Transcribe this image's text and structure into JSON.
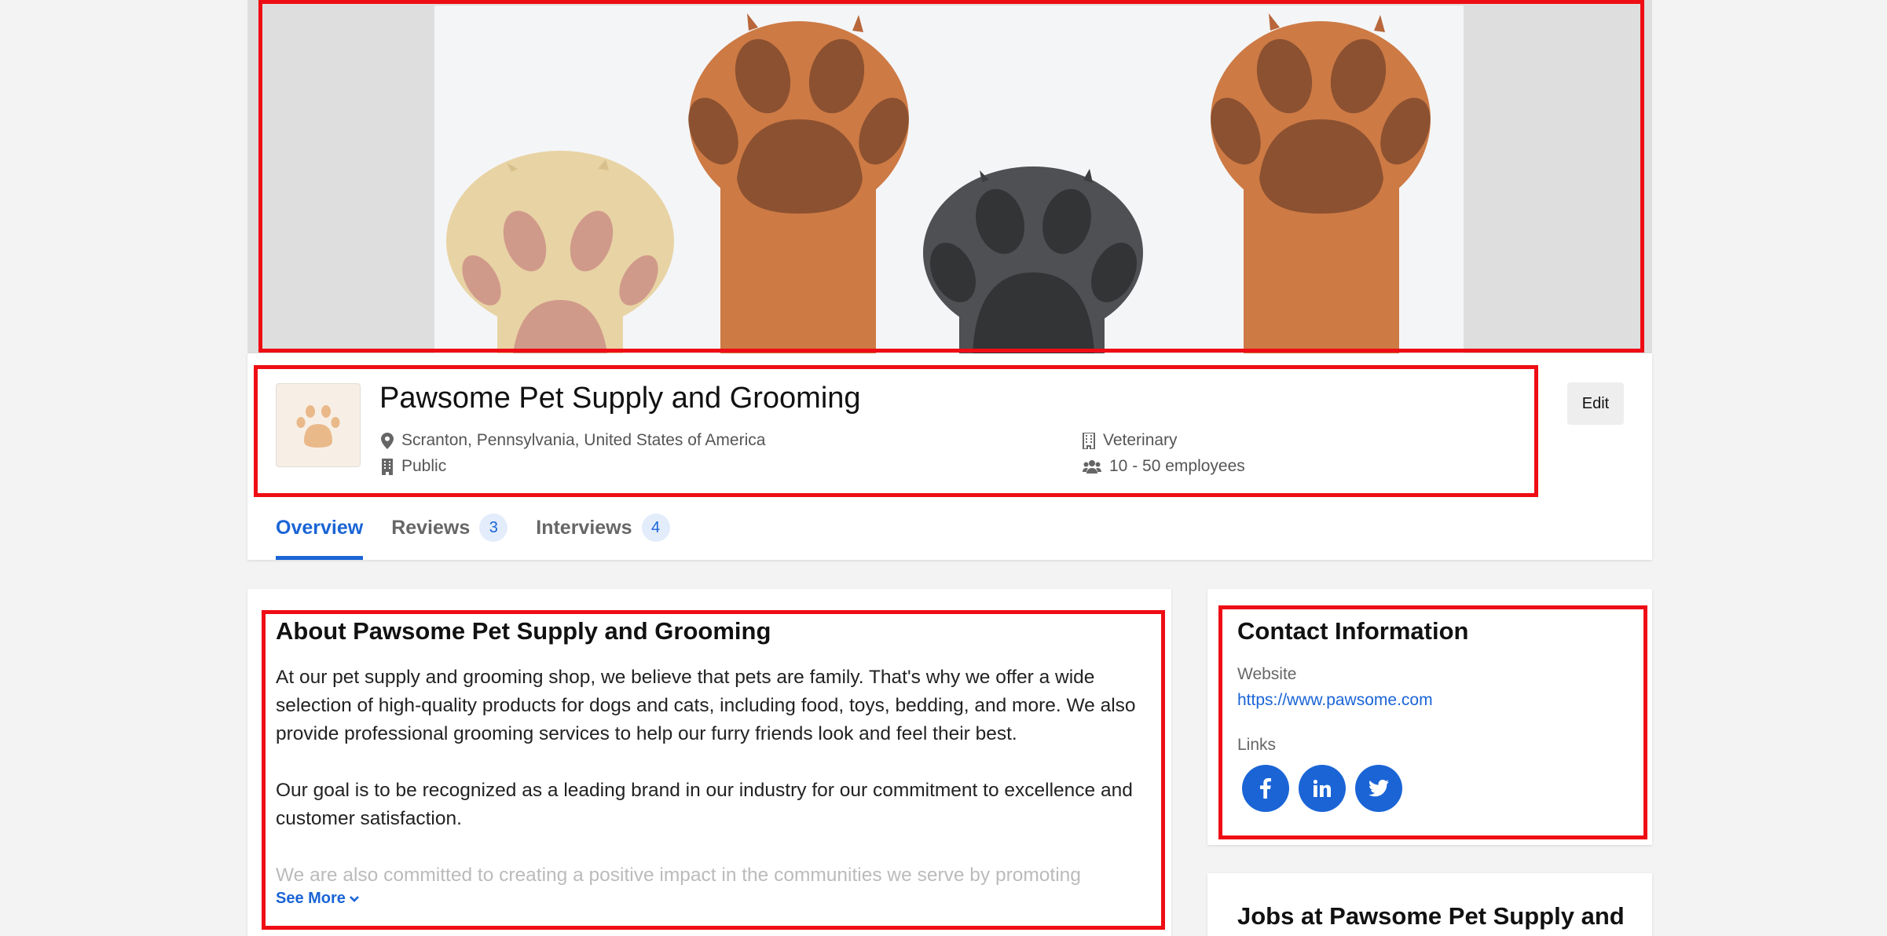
{
  "company": {
    "name": "Pawsome Pet Supply and Grooming",
    "location": "Scranton, Pennsylvania, United States of America",
    "ownership": "Public",
    "industry": "Veterinary",
    "size": "10 - 50 employees"
  },
  "actions": {
    "edit_label": "Edit"
  },
  "tabs": [
    {
      "label": "Overview",
      "active": true
    },
    {
      "label": "Reviews",
      "count": "3"
    },
    {
      "label": "Interviews",
      "count": "4"
    }
  ],
  "about": {
    "title": "About Pawsome Pet Supply and Grooming",
    "paragraphs": [
      "At our pet supply and grooming shop, we believe that pets are family. That's why we offer a wide selection of high-quality products for dogs and cats, including food, toys, bedding, and more. We also provide professional grooming services to help our furry friends look and feel their best.",
      "Our goal is to be recognized as a leading brand in our industry for our commitment to excellence and customer satisfaction.",
      "We are also committed to creating a positive impact in the communities we serve by promoting"
    ],
    "see_more_label": "See More"
  },
  "contact": {
    "title": "Contact Information",
    "website_label": "Website",
    "website_url": "https://www.pawsome.com",
    "links_label": "Links",
    "social": [
      "facebook-icon",
      "linkedin-icon",
      "twitter-icon"
    ]
  },
  "jobs": {
    "title": "Jobs at Pawsome Pet Supply and"
  },
  "colors": {
    "accent": "#1a64d6",
    "highlight_outline": "#ee0d14",
    "paw_light": "#e8d3a4",
    "paw_orange": "#cd7a45",
    "paw_dark": "#4f5053"
  }
}
